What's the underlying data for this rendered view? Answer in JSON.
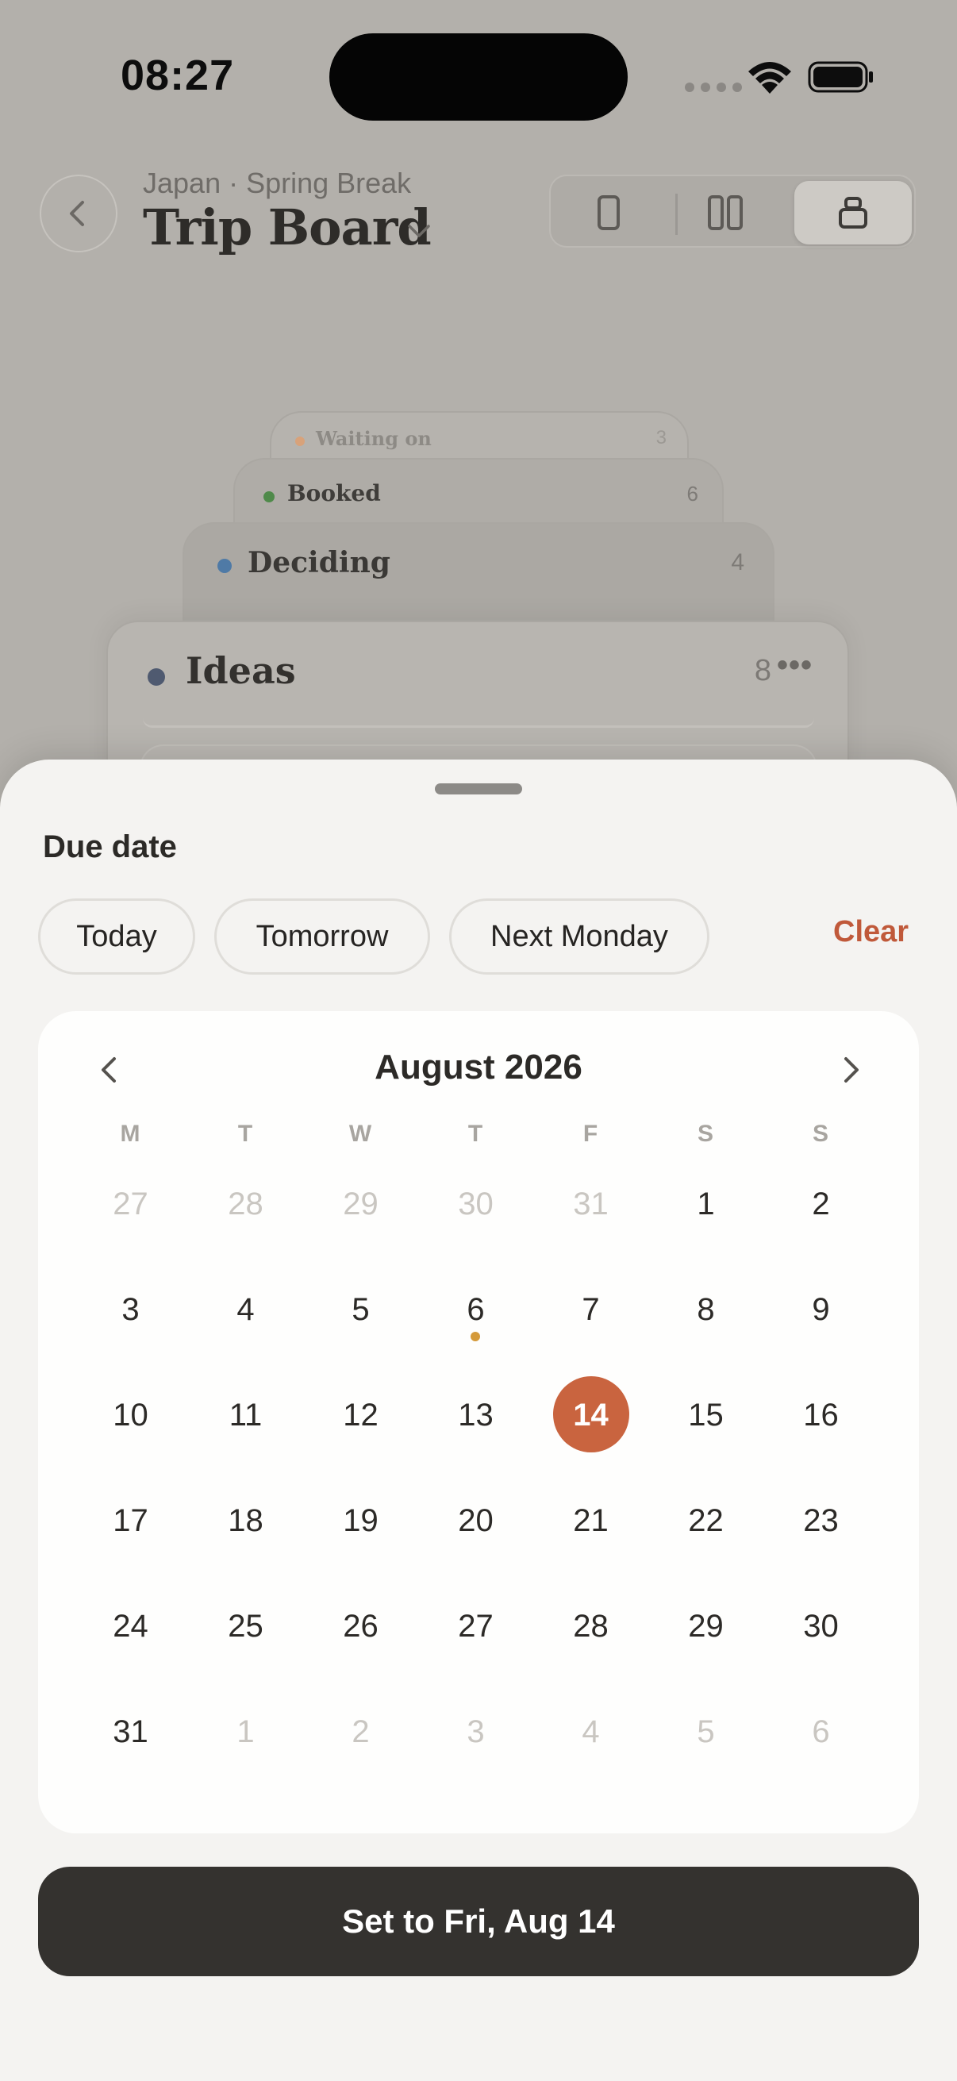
{
  "status_bar": {
    "time": "08:27"
  },
  "header": {
    "subtitle": "Japan · Spring Break",
    "title": "Trip Board",
    "view_modes": [
      "single-column-view-icon",
      "two-column-view-icon",
      "stack-view-icon"
    ],
    "selected_view": "stack"
  },
  "columns": [
    {
      "name": "Waiting on",
      "count": "3",
      "color": "#d8a27a"
    },
    {
      "name": "Booked",
      "count": "6",
      "color": "#4f8a4a"
    },
    {
      "name": "Deciding",
      "count": "4",
      "color": "#4f7aa6"
    },
    {
      "name": "Ideas",
      "count": "8",
      "color": "#4f5a70"
    }
  ],
  "sheet": {
    "title": "Due date",
    "quick_options": [
      "Today",
      "Tomorrow",
      "Next Monday"
    ],
    "clear_label": "Clear",
    "calendar": {
      "month_label": "August 2026",
      "weekdays": [
        "M",
        "T",
        "W",
        "T",
        "F",
        "S",
        "S"
      ],
      "weeks": [
        [
          [
            "27",
            0
          ],
          [
            "28",
            0
          ],
          [
            "29",
            0
          ],
          [
            "30",
            0
          ],
          [
            "31",
            0
          ],
          [
            "1",
            1
          ],
          [
            "2",
            1
          ]
        ],
        [
          [
            "3",
            1
          ],
          [
            "4",
            1
          ],
          [
            "5",
            1
          ],
          [
            "6",
            1
          ],
          [
            "7",
            1
          ],
          [
            "8",
            1
          ],
          [
            "9",
            1
          ]
        ],
        [
          [
            "10",
            1
          ],
          [
            "11",
            1
          ],
          [
            "12",
            1
          ],
          [
            "13",
            1
          ],
          [
            "14",
            1
          ],
          [
            "15",
            1
          ],
          [
            "16",
            1
          ]
        ],
        [
          [
            "17",
            1
          ],
          [
            "18",
            1
          ],
          [
            "19",
            1
          ],
          [
            "20",
            1
          ],
          [
            "21",
            1
          ],
          [
            "22",
            1
          ],
          [
            "23",
            1
          ]
        ],
        [
          [
            "24",
            1
          ],
          [
            "25",
            1
          ],
          [
            "26",
            1
          ],
          [
            "27",
            1
          ],
          [
            "28",
            1
          ],
          [
            "29",
            1
          ],
          [
            "30",
            1
          ]
        ],
        [
          [
            "31",
            1
          ],
          [
            "1",
            0
          ],
          [
            "2",
            0
          ],
          [
            "3",
            0
          ],
          [
            "4",
            0
          ],
          [
            "5",
            0
          ],
          [
            "6",
            0
          ]
        ]
      ],
      "selected_day": "14",
      "today_marker_day": "6",
      "selected_color": "#c9643f"
    },
    "confirm_label": "Set to Fri, Aug 14"
  }
}
